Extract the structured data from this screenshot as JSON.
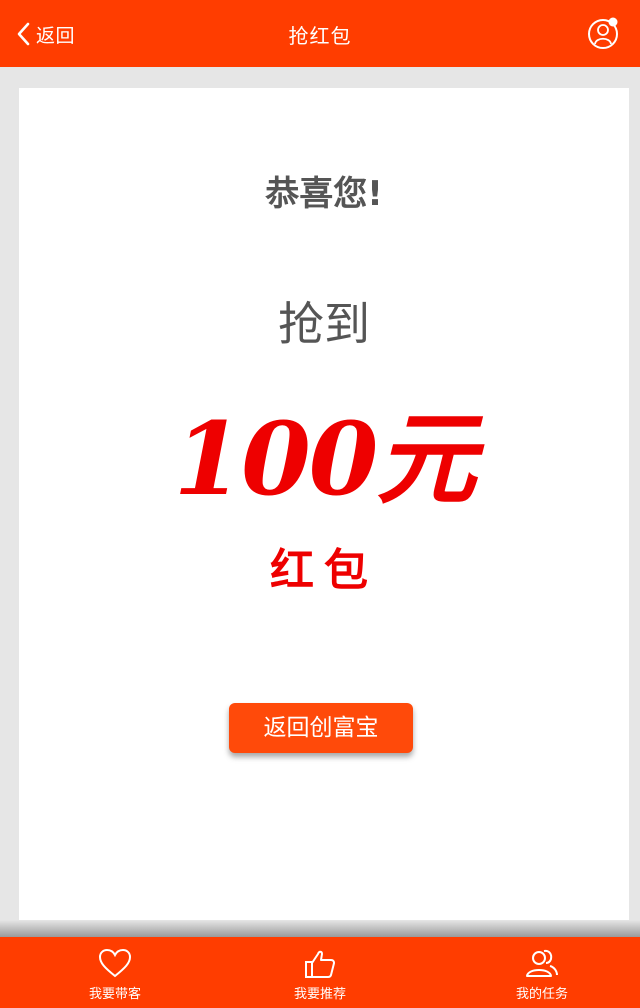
{
  "header": {
    "back_label": "返回",
    "title": "抢红包"
  },
  "card": {
    "congrats": "恭喜您!",
    "got": "抢到",
    "amount": "100元",
    "hongbao": "红包",
    "return_button": "返回创富宝"
  },
  "tabbar": {
    "items": [
      {
        "label": "我要带客",
        "icon": "heart-icon"
      },
      {
        "label": "我要推荐",
        "icon": "thumbs-up-icon"
      },
      {
        "label": "我的任务",
        "icon": "users-icon"
      }
    ]
  },
  "colors": {
    "brand": "#ff3d00",
    "amount": "#ee0000",
    "text_gray": "#555555"
  }
}
